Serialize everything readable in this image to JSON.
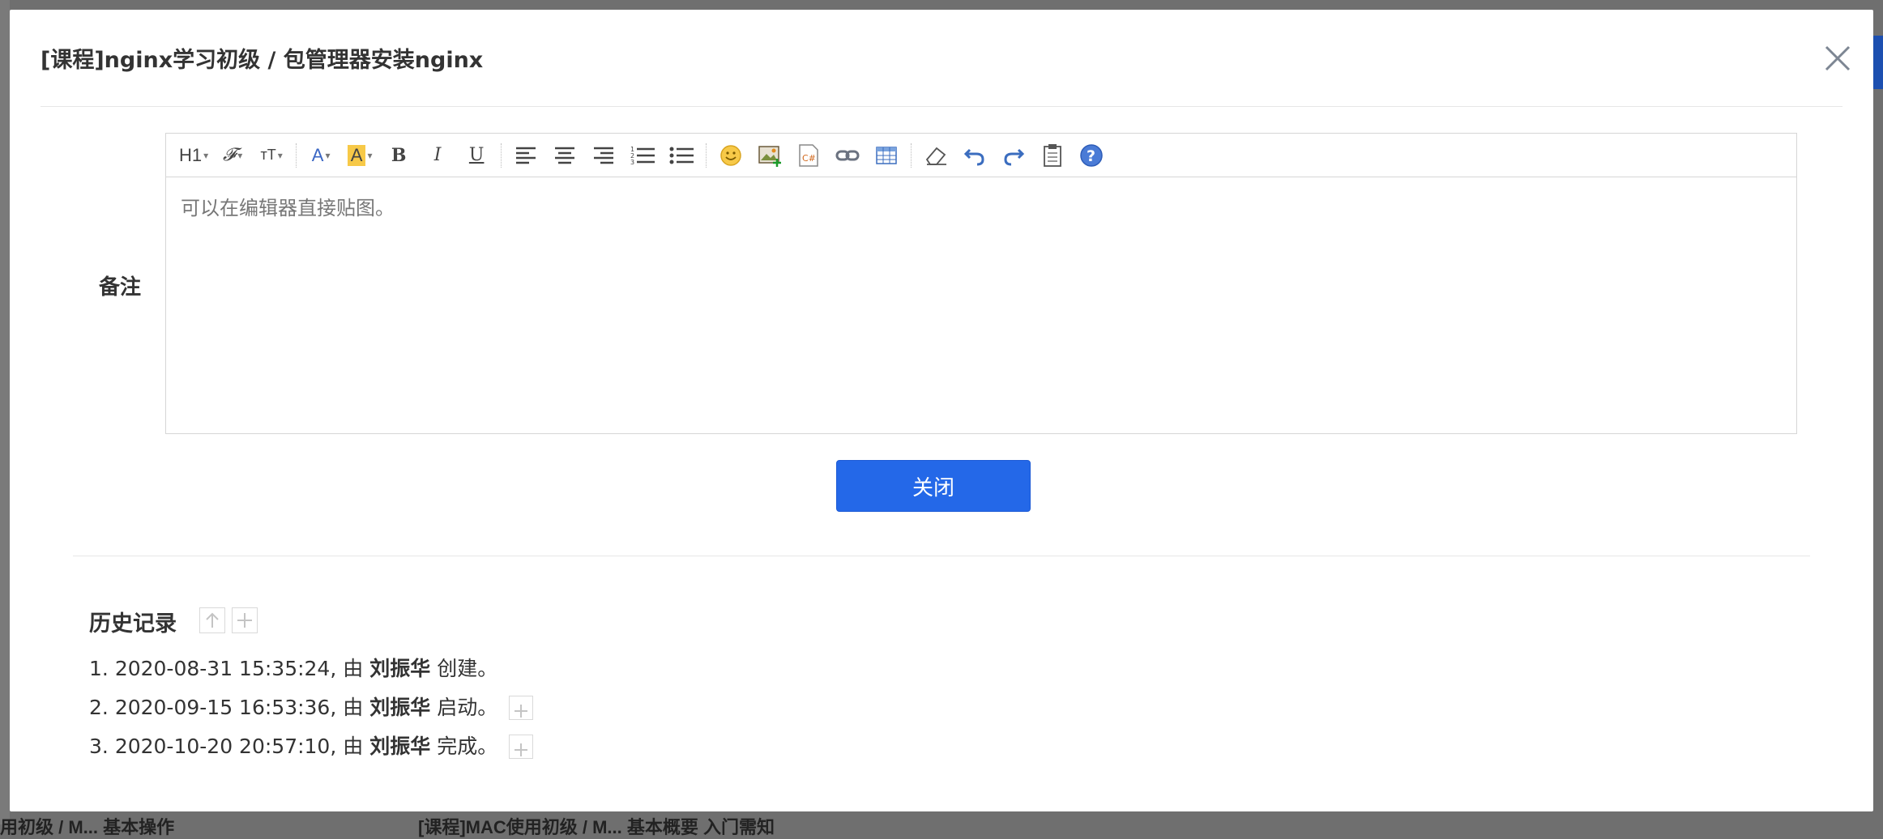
{
  "background": {
    "fragments": [
      "用初级 / M... 基本操作",
      "[课程]MAC使用初级 / M... 基本概要 入门需知"
    ]
  },
  "modal": {
    "title": "[课程]nginx学习初级 / 包管理器安装nginx",
    "close_icon": "close-icon"
  },
  "form": {
    "remark_label": "备注",
    "editor_placeholder": "可以在编辑器直接贴图。",
    "toolbar": {
      "heading": "H1",
      "font_family": "𝓕",
      "font_size": "тT",
      "font_color": "A",
      "bg_color": "A",
      "bold": "B",
      "italic": "I",
      "underline": "U"
    }
  },
  "close_button": "关闭",
  "history": {
    "title": "历史记录",
    "items": [
      {
        "index": "1.",
        "time": "2020-08-31 15:35:24, 由",
        "user": "刘振华",
        "action": "创建。",
        "expandable": false
      },
      {
        "index": "2.",
        "time": "2020-09-15 16:53:36, 由",
        "user": "刘振华",
        "action": "启动。",
        "expandable": true
      },
      {
        "index": "3.",
        "time": "2020-10-20 20:57:10, 由",
        "user": "刘振华",
        "action": "完成。",
        "expandable": true
      }
    ]
  },
  "colors": {
    "primary": "#2468e8",
    "overlay": "#6f6f6f"
  }
}
